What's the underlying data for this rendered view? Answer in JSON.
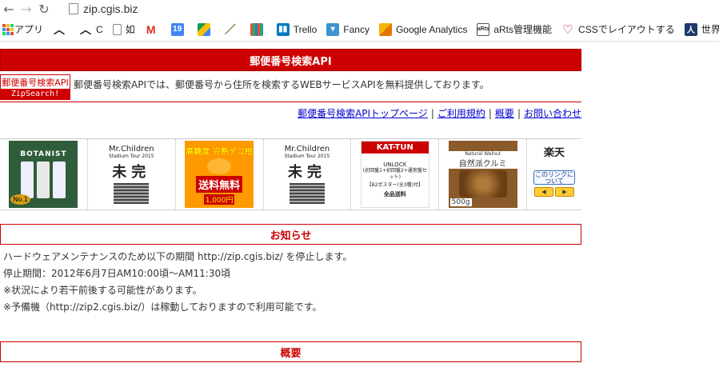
{
  "browser": {
    "url": "zip.cgis.biz"
  },
  "bookmarks": [
    {
      "label": "アプリ",
      "icon": "apps-icon"
    },
    {
      "label": "",
      "icon": "wave-icon"
    },
    {
      "label": "C",
      "icon": "wave-icon"
    },
    {
      "label": "如",
      "icon": "page-icon"
    },
    {
      "label": "",
      "icon": "gmail-icon"
    },
    {
      "label": "",
      "icon": "calendar-icon"
    },
    {
      "label": "",
      "icon": "drive-icon"
    },
    {
      "label": "",
      "icon": "brush-icon"
    },
    {
      "label": "",
      "icon": "grid-icon"
    },
    {
      "label": "Trello",
      "icon": "trello-icon"
    },
    {
      "label": "Fancy",
      "icon": "fancy-icon"
    },
    {
      "label": "Google Analytics",
      "icon": "analytics-icon"
    },
    {
      "label": "aRts管理機能",
      "icon": "arts-icon"
    },
    {
      "label": "CSSでレイアウトする",
      "icon": "heart-icon"
    },
    {
      "label": "世界で",
      "icon": "person-icon"
    }
  ],
  "page": {
    "title": "郵便番号検索API",
    "logo_top": "郵便番号検索API",
    "logo_bottom": "ZipSearch!",
    "intro": "郵便番号検索APIでは、郵便番号から住所を検索するWEBサービスAPIを無料提供しております。",
    "links": [
      "郵便番号検索APIトップページ",
      "ご利用規約",
      "概要",
      "お問い合わせ"
    ],
    "ads": [
      {
        "name": "botanist",
        "label": "BOTANIST",
        "badge": "No.1",
        "bg": "#2f5c3a"
      },
      {
        "name": "mr-children-1",
        "label": "Mr.Children",
        "sub": "Stadium Tour 2015",
        "big": "未完",
        "bg": "#ffffff"
      },
      {
        "name": "coffee-jelly",
        "label": "高糖度 完熟デコ柑",
        "sub": "送料無料",
        "price": "1,000円",
        "bg": "#ff9900"
      },
      {
        "name": "mr-children-2",
        "label": "Mr.Children",
        "sub": "Stadium Tour 2015",
        "big": "未完",
        "bg": "#ffffff"
      },
      {
        "name": "kat-tun",
        "label": "KAT-TUN",
        "sub": "UNLOCK",
        "detail": "(初回盤1+初回盤2+通常盤セット)",
        "extra": "【B2ポスター(全3種)付】",
        "ship": "全品送料",
        "bg": "#ffffff"
      },
      {
        "name": "walnut",
        "label": "自然派クルミ",
        "sub": "Natural Walnut",
        "weight": "500g",
        "bg": "#8a5a2a"
      }
    ],
    "rakuten": {
      "label": "楽天",
      "button": "このリンクについて",
      "prev": "◀",
      "next": "▶"
    },
    "notice_heading": "お知らせ",
    "notice_lines": [
      "ハードウェアメンテナンスのため以下の期間 http://zip.cgis.biz/ を停止します。",
      "停止期間：2012年6月7日AM10:00頃〜AM11:30頃",
      "※状況により若干前後する可能性があります。",
      "※予備機（http://zip2.cgis.biz/）は稼動しておりますので利用可能です。"
    ],
    "overview_heading": "概要"
  }
}
